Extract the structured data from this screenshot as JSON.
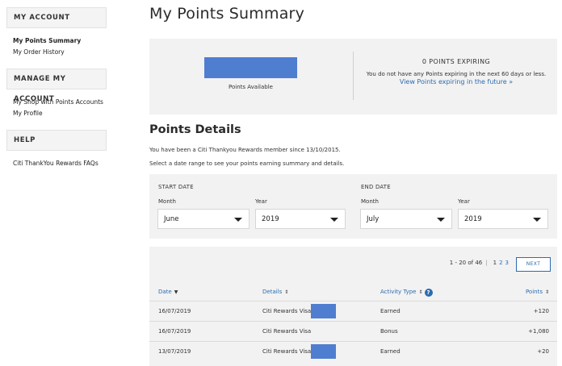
{
  "sidebar": {
    "sections": [
      {
        "title": "MY ACCOUNT",
        "links": [
          "My Points Summary",
          "My Order History"
        ]
      },
      {
        "title": "MANAGE MY ACCOUNT",
        "links": [
          "My Shop with Points Accounts",
          "My Profile"
        ]
      },
      {
        "title": "HELP",
        "links": [
          "Citi ThankYou Rewards FAQs"
        ]
      }
    ]
  },
  "page": {
    "title": "My Points Summary"
  },
  "summary": {
    "points_label": "Points Available",
    "expiring_title": "0 POINTS EXPIRING",
    "expiring_text": "You do not have any Points expiring in the next 60 days or less.",
    "expiring_link": "View Points expiring in the future »"
  },
  "details": {
    "title": "Points Details",
    "member_text": "You have been a Citi Thankyou Rewards member since 13/10/2015.",
    "range_text": "Select a date range to see your points earning summary and details."
  },
  "filters": {
    "start_label": "START DATE",
    "end_label": "END DATE",
    "month_label": "Month",
    "year_label": "Year",
    "start_month": "June",
    "start_year": "2019",
    "end_month": "July",
    "end_year": "2019"
  },
  "pagination": {
    "range": "1 - 20 of 46",
    "pages": [
      "1",
      "2",
      "3"
    ],
    "next_label": "NEXT"
  },
  "table": {
    "headers": {
      "date": "Date",
      "details": "Details",
      "activity": "Activity Type",
      "points": "Points"
    },
    "rows": [
      {
        "date": "16/07/2019",
        "details": "Citi Rewards Visa",
        "activity": "Earned",
        "points": "+120"
      },
      {
        "date": "16/07/2019",
        "details": "Citi Rewards Visa",
        "activity": "Bonus",
        "points": "+1,080"
      },
      {
        "date": "13/07/2019",
        "details": "Citi Rewards Visa",
        "activity": "Earned",
        "points": "+20"
      }
    ]
  },
  "colors": {
    "link": "#2b6cb0",
    "panel": "#f2f2f2",
    "redaction": "#4f7ed0"
  }
}
